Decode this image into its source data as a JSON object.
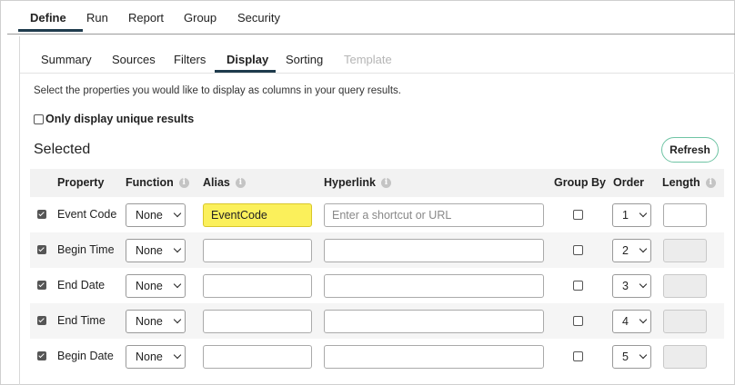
{
  "top_tabs": [
    "Define",
    "Run",
    "Report",
    "Group",
    "Security"
  ],
  "sub_tabs": [
    "Summary",
    "Sources",
    "Filters",
    "Display",
    "Sorting",
    "Template"
  ],
  "instructions": "Select the properties you would like to display as columns in your query results.",
  "unique_label": "Only display unique results",
  "selected_title": "Selected",
  "refresh_label": "Refresh",
  "headers": {
    "property": "Property",
    "function": "Function",
    "alias": "Alias",
    "hyperlink": "Hyperlink",
    "group_by": "Group By",
    "order": "Order",
    "length": "Length"
  },
  "hyperlink_placeholder": "Enter a shortcut or URL",
  "rows": [
    {
      "property": "Event Code",
      "function": "None",
      "alias": "EventCode",
      "order": "1"
    },
    {
      "property": "Begin Time",
      "function": "None",
      "alias": "",
      "order": "2"
    },
    {
      "property": "End Date",
      "function": "None",
      "alias": "",
      "order": "3"
    },
    {
      "property": "End Time",
      "function": "None",
      "alias": "",
      "order": "4"
    },
    {
      "property": "Begin Date",
      "function": "None",
      "alias": "",
      "order": "5"
    }
  ],
  "colors": {
    "alias_highlight": "#fbf05b",
    "refresh_border": "#6fc4a4",
    "tab_underline": "#1f3b4d"
  },
  "icons": {
    "info": "info-icon",
    "chevron": "chevron-down-icon",
    "checkbox": "checkbox-icon"
  }
}
